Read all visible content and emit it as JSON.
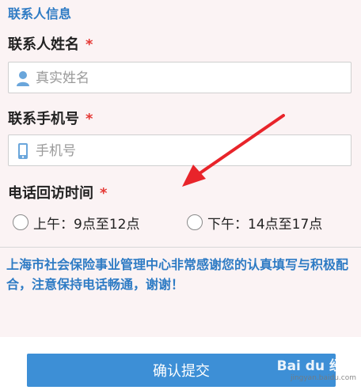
{
  "section_title": "联系人信息",
  "fields": {
    "name": {
      "label": "联系人姓名",
      "required": "*",
      "placeholder": "真实姓名",
      "icon": "person-icon"
    },
    "phone": {
      "label": "联系手机号",
      "required": "*",
      "placeholder": "手机号",
      "icon": "mobile-phone-icon"
    }
  },
  "callback": {
    "label": "电话回访时间",
    "required": "*",
    "options": [
      "上午：9点至12点",
      "下午：14点至17点"
    ]
  },
  "notice": "上海市社会保险事业管理中心非常感谢您的认真填写与积极配合，注意保持电话畅通，谢谢！",
  "submit_label": "确认提交",
  "watermark": {
    "brand": "Bai du 经验",
    "url": "jingyan.baidu.com"
  },
  "colors": {
    "accent": "#2e7bc4",
    "required": "#e53935",
    "button": "#3d8fd6",
    "arrow": "#e8242a"
  }
}
